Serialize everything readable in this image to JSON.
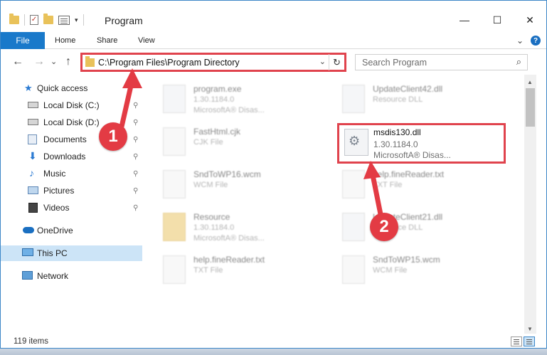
{
  "window": {
    "title": "Program",
    "controls": {
      "minimize": "—",
      "maximize": "☐",
      "close": "✕"
    }
  },
  "ribbon": {
    "tabs": [
      "File",
      "Home",
      "Share",
      "View"
    ],
    "expand": "⌄",
    "help": "?"
  },
  "nav": {
    "back": "←",
    "forward": "→",
    "recent": "⌄",
    "up": "↑",
    "address": "C:\\Program Files\\Program Directory",
    "address_dropdown": "⌄",
    "refresh": "↻",
    "search_placeholder": "Search Program",
    "search_icon": "⌕"
  },
  "sidebar": {
    "items": [
      {
        "label": "Quick access",
        "icon": "star-icon",
        "pinned": false
      },
      {
        "label": "Local Disk (C:)",
        "icon": "drive-icon",
        "pinned": true
      },
      {
        "label": "Local Disk (D:)",
        "icon": "drive-icon",
        "pinned": true
      },
      {
        "label": "Documents",
        "icon": "documents-icon",
        "pinned": true
      },
      {
        "label": "Downloads",
        "icon": "download-icon",
        "pinned": true
      },
      {
        "label": "Music",
        "icon": "music-icon",
        "pinned": true
      },
      {
        "label": "Pictures",
        "icon": "pictures-icon",
        "pinned": true
      },
      {
        "label": "Videos",
        "icon": "videos-icon",
        "pinned": true
      },
      {
        "label": "OneDrive",
        "icon": "cloud-icon",
        "pinned": false
      },
      {
        "label": "This PC",
        "icon": "pc-icon",
        "pinned": false,
        "selected": true
      },
      {
        "label": "Network",
        "icon": "network-icon",
        "pinned": false
      }
    ],
    "pin_glyph": "📌"
  },
  "files": [
    {
      "name": "program.exe",
      "line2": "1.30.1184.0",
      "line3": "MicrosoftA® Disas...",
      "icon": "exe-icon"
    },
    {
      "name": "UpdateClient42.dll",
      "line2": "Resource DLL",
      "line3": "",
      "icon": "dll-icon"
    },
    {
      "name": "FastHtml.cjk",
      "line2": "CJK File",
      "line3": "",
      "icon": "file-icon"
    },
    {
      "name": "SndToWP16.wcm",
      "line2": "WCM File",
      "line3": "",
      "icon": "file-icon"
    },
    {
      "name": "help.fineReader.txt",
      "line2": "TXT File",
      "line3": "",
      "icon": "file-icon"
    },
    {
      "name": "Resource",
      "line2": "1.30.1184.0",
      "line3": "MicrosoftA® Disas...",
      "icon": "folder-icon"
    },
    {
      "name": "UpdateClient21.dll",
      "line2": "Resource DLL",
      "line3": "",
      "icon": "dll-icon"
    },
    {
      "name": "help.fineReader.txt",
      "line2": "TXT File",
      "line3": "",
      "icon": "file-icon"
    },
    {
      "name": "SndToWP15.wcm",
      "line2": "WCM File",
      "line3": "",
      "icon": "file-icon"
    }
  ],
  "highlighted_file": {
    "name": "msdis130.dll",
    "version": "1.30.1184.0",
    "company": "MicrosoftA® Disas...",
    "icon": "dll-gear-icon"
  },
  "status": {
    "count": "119 items"
  },
  "callouts": {
    "one": "1",
    "two": "2"
  },
  "colors": {
    "accent": "#1979ca",
    "callout": "#e33b44",
    "selected": "#cce4f7"
  }
}
